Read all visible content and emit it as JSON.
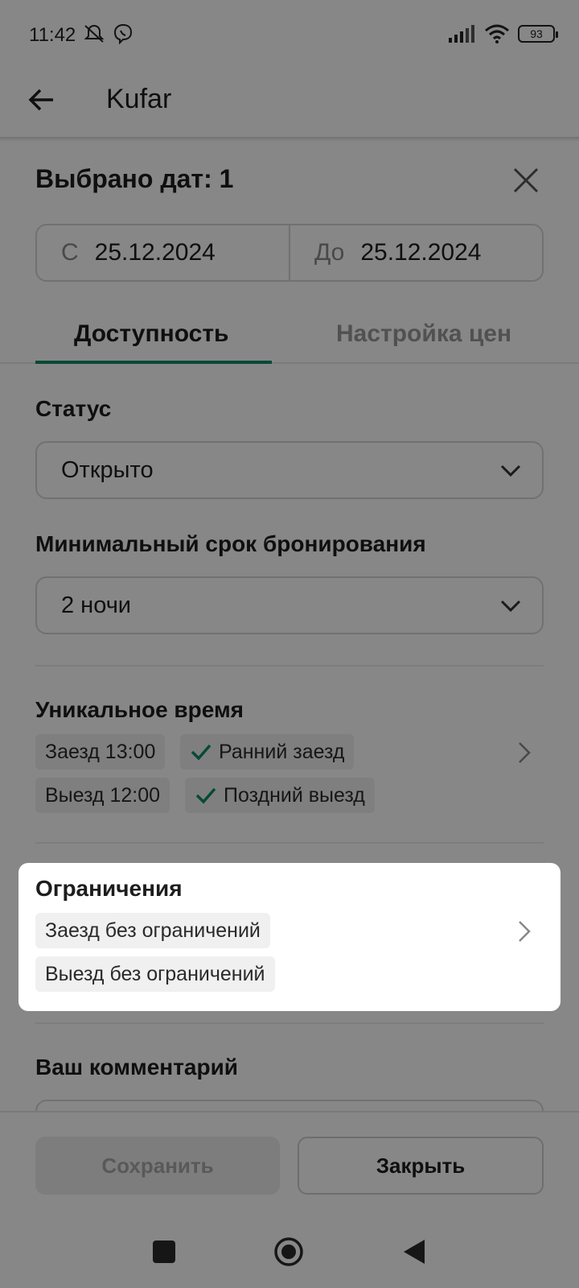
{
  "status_bar": {
    "time": "11:42",
    "battery": "93"
  },
  "app_bar": {
    "title": "Kufar"
  },
  "sheet": {
    "title": "Выбрано дат: 1",
    "date_from_prefix": "С",
    "date_from": "25.12.2024",
    "date_to_prefix": "До",
    "date_to": "25.12.2024"
  },
  "tabs": [
    {
      "label": "Доступность",
      "active": true
    },
    {
      "label": "Настройка цен",
      "active": false
    }
  ],
  "status_section": {
    "label": "Статус",
    "value": "Открыто"
  },
  "min_stay_section": {
    "label": "Минимальный срок бронирования",
    "value": "2 ночи"
  },
  "unique_time": {
    "label": "Уникальное время",
    "checkin": "Заезд 13:00",
    "early_checkin": "Ранний заезд",
    "checkout": "Выезд 12:00",
    "late_checkout": "Поздний выезд"
  },
  "restrictions": {
    "label": "Ограничения",
    "checkin": "Заезд без ограничений",
    "checkout": "Выезд без ограничений"
  },
  "comment": {
    "label": "Ваш комментарий"
  },
  "buttons": {
    "save": "Сохранить",
    "close": "Закрыть"
  },
  "colors": {
    "accent": "#0e8a67",
    "overlay": "rgba(0,0,0,0.47)"
  }
}
